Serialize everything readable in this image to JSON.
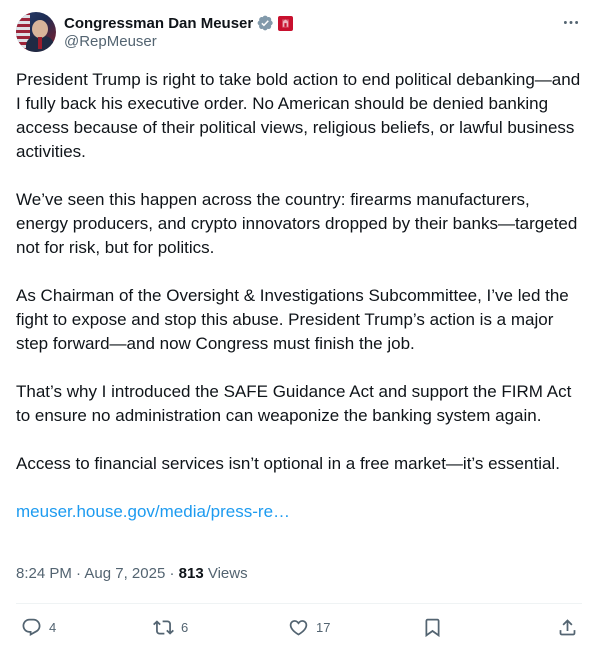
{
  "author": {
    "display_name": "Congressman Dan Meuser",
    "handle": "@RepMeuser"
  },
  "tweet": {
    "paragraphs": [
      "President Trump is right to take bold action to end political debanking—and I fully back his executive order. No American should be denied banking access because of their political views, religious beliefs, or lawful business activities.",
      "We’ve seen this happen across the country: firearms manufacturers, energy producers, and crypto innovators dropped by their banks—targeted not for risk, but for politics.",
      "As Chairman of the Oversight & Investigations Subcommittee, I’ve led the fight to expose and stop this abuse. President Trump’s action is a major step forward—and now Congress must finish the job.",
      "That’s why I introduced the SAFE Guidance Act and support the FIRM Act to ensure no administration can weaponize the banking system again.",
      "Access to financial services isn’t optional in a free market—it’s essential."
    ],
    "link_text": "meuser.house.gov/media/press-re…"
  },
  "meta": {
    "time": "8:24 PM",
    "separator": " · ",
    "date": "Aug 7, 2025",
    "views_count": "813",
    "views_label": " Views"
  },
  "actions": {
    "replies": "4",
    "reposts": "6",
    "likes": "17"
  },
  "colors": {
    "text": "#0f1419",
    "secondary": "#536471",
    "link": "#1d9bf0",
    "verified": "#829aab",
    "affiliation": "#c8102e",
    "divider": "#eff3f4"
  },
  "icons": [
    "verified-badge-icon",
    "house-affiliation-icon",
    "more-options-icon",
    "reply-icon",
    "repost-icon",
    "like-icon",
    "bookmark-icon",
    "share-icon"
  ]
}
